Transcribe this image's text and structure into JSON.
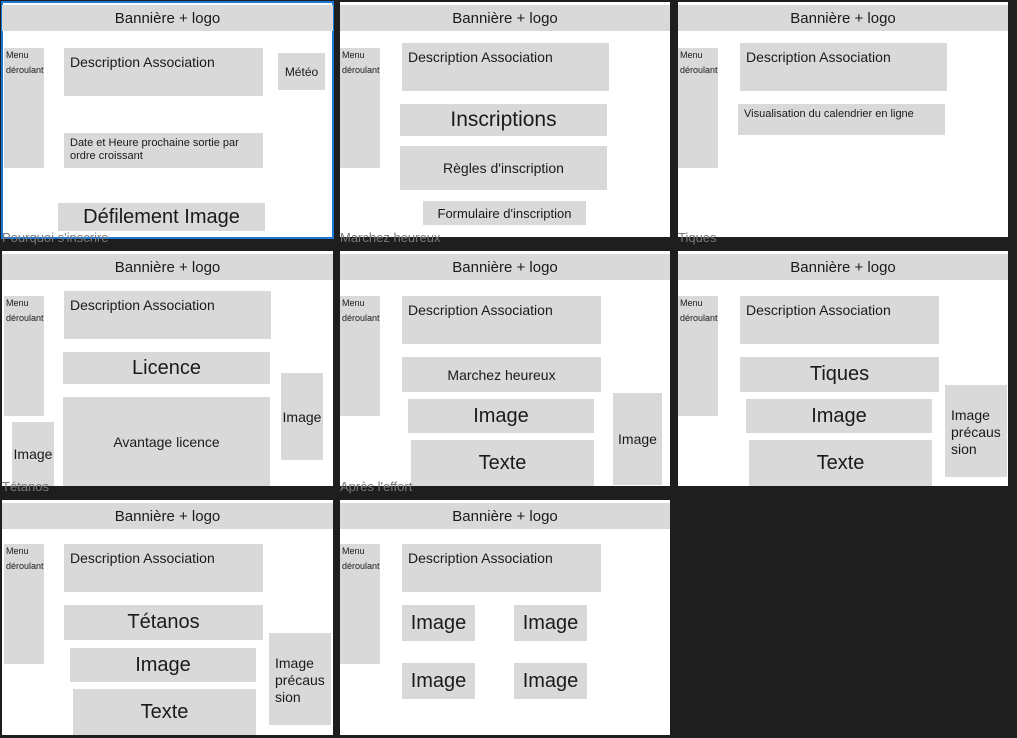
{
  "frame_labels": {
    "f4": "Pourquoi s'inscrire",
    "f5": "Marchez heureux",
    "f6": "Tiques",
    "f7": "Tétanos",
    "f8": "Après l'effort"
  },
  "common": {
    "banner": "Bannière + logo",
    "menu_line1": "Menu",
    "menu_line2": "déroulant",
    "description": "Description Association",
    "image": "Image",
    "texte": "Texte",
    "image_precaution_1": "Image",
    "image_precaution_2": "précaus",
    "image_precaution_3": "sion"
  },
  "frame1": {
    "meteo": "Météo",
    "next_outing": "Date et Heure prochaine sortie par ordre croissant",
    "slideshow": "Défilement Image"
  },
  "frame2": {
    "inscriptions": "Inscriptions",
    "rules": "Règles d'inscription",
    "form": "Formulaire d'inscription"
  },
  "frame3": {
    "calendar": "Visualisation du calendrier en ligne"
  },
  "frame4": {
    "licence": "Licence",
    "advantage": "Avantage licence"
  },
  "frame5": {
    "title": "Marchez heureux"
  },
  "frame6": {
    "title": "Tiques"
  },
  "frame7": {
    "title": "Tétanos"
  }
}
